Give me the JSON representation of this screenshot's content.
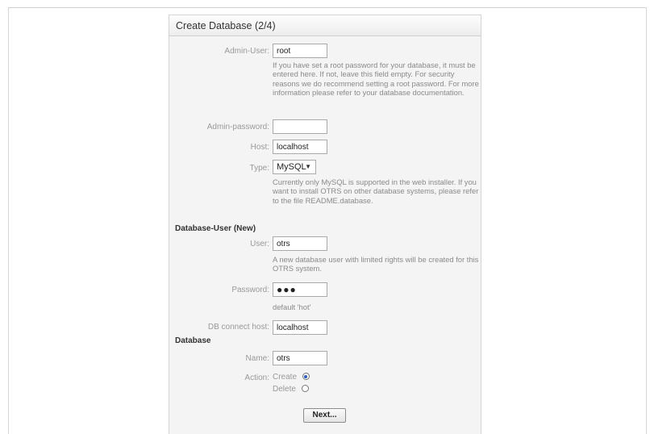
{
  "panel": {
    "title": "Create Database (2/4)"
  },
  "admin": {
    "user_label": "Admin-User:",
    "user_value": "root",
    "user_hint": "If you have set a root password for your database, it must be entered here. If not, leave this field empty. For security reasons we do recommend setting a root password. For more information please refer to your database documentation.",
    "password_label": "Admin-password:",
    "password_value": "",
    "host_label": "Host:",
    "host_value": "localhost",
    "type_label": "Type:",
    "type_value": "MySQL",
    "type_hint": "Currently only MySQL is supported in the web installer. If you want to install OTRS on other database systems, please refer to the file README.database."
  },
  "db_user": {
    "section_title": "Database-User (New)",
    "user_label": "User:",
    "user_value": "otrs",
    "user_hint": "A new database user with limited rights will be created for this OTRS system.",
    "password_label": "Password:",
    "password_value": "●●●",
    "password_hint": "default 'hot'",
    "connect_host_label": "DB connect host:",
    "connect_host_value": "localhost"
  },
  "database": {
    "section_title": "Database",
    "name_label": "Name:",
    "name_value": "otrs",
    "action_label": "Action:",
    "action_create": "Create",
    "action_delete": "Delete",
    "selected_action": "Create"
  },
  "buttons": {
    "next_label": "Next..."
  }
}
